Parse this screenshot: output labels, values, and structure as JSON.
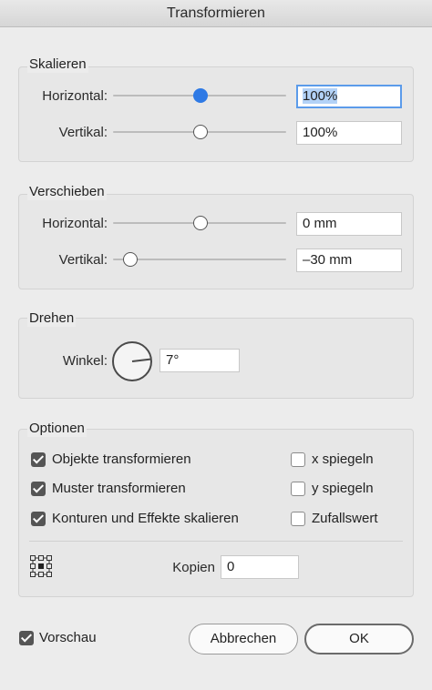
{
  "window": {
    "title": "Transformieren"
  },
  "scale": {
    "legend": "Skalieren",
    "horizontal": {
      "label": "Horizontal:",
      "value": "100%",
      "slider_level": 0.5
    },
    "vertical": {
      "label": "Vertikal:",
      "value": "100%",
      "slider_level": 0.5
    }
  },
  "move": {
    "legend": "Verschieben",
    "horizontal": {
      "label": "Horizontal:",
      "value": "0 mm",
      "slider_level": 0.5
    },
    "vertical": {
      "label": "Vertikal:",
      "value": "–30 mm",
      "slider_level": 0.1
    }
  },
  "rotate": {
    "legend": "Drehen",
    "angle_label": "Winkel:",
    "angle_value": "7°"
  },
  "options": {
    "legend": "Optionen",
    "checkboxes": [
      {
        "label": "Objekte transformieren",
        "checked": true
      },
      {
        "label": "Muster transformieren",
        "checked": true
      },
      {
        "label": "Konturen und Effekte skalieren",
        "checked": true
      },
      {
        "label": "x spiegeln",
        "checked": false
      },
      {
        "label": "y spiegeln",
        "checked": false
      },
      {
        "label": "Zufallswert",
        "checked": false
      }
    ],
    "copies_label": "Kopien",
    "copies_value": "0"
  },
  "footer": {
    "preview_label": "Vorschau",
    "preview_checked": true,
    "cancel_label": "Abbrechen",
    "ok_label": "OK"
  },
  "colors": {
    "accent": "#2f7ae5",
    "focus_ring": "#5b9bea",
    "selection": "#b3d2f7"
  }
}
